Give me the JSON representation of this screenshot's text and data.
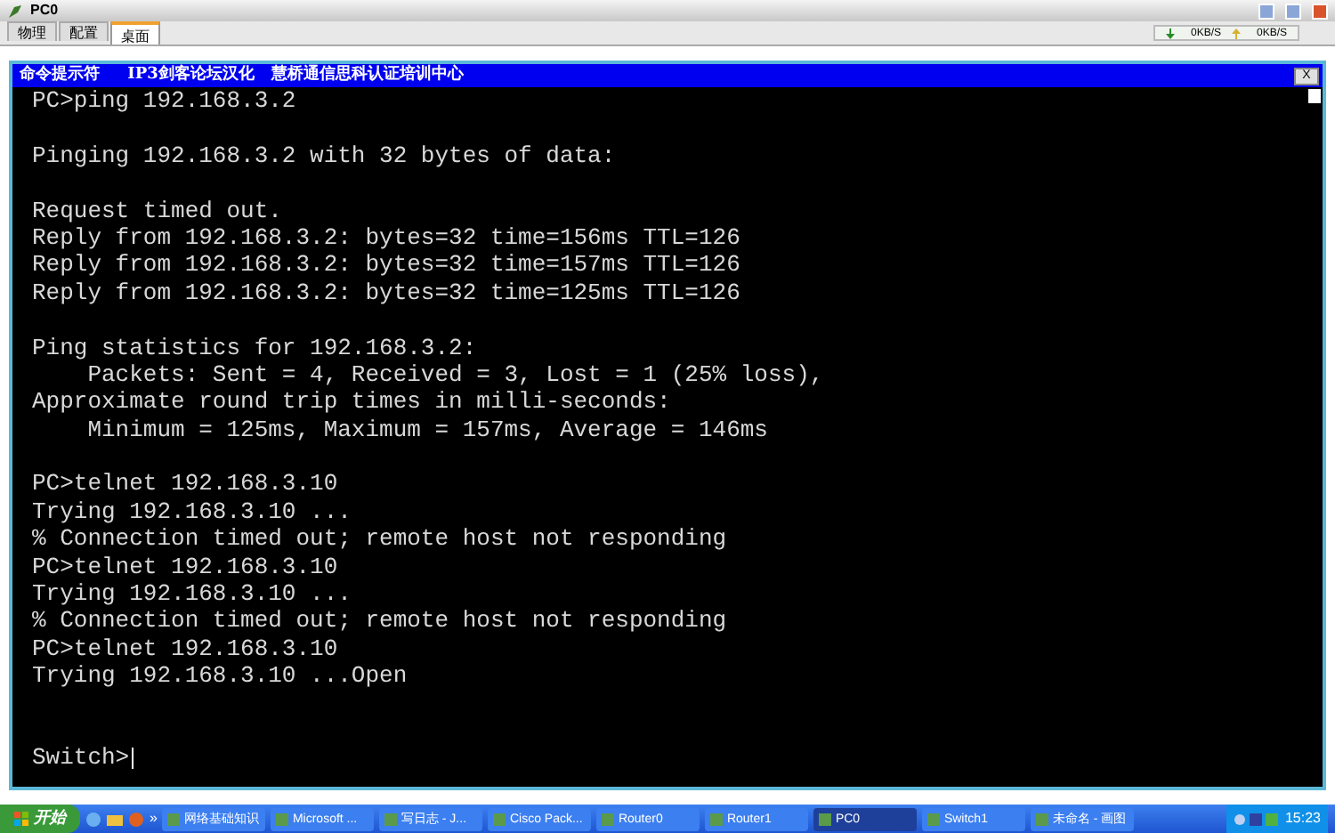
{
  "window": {
    "title": "PC0"
  },
  "tabs": [
    {
      "label": "物理",
      "selected": false
    },
    {
      "label": "配置",
      "selected": false
    },
    {
      "label": "桌面",
      "selected": true
    }
  ],
  "net_speed": {
    "download": "0KB/S",
    "upload": "0KB/S"
  },
  "console": {
    "title": "命令提示符     IP3剑客论坛汉化   慧桥通信思科认证培训中心",
    "close": "X",
    "lines": [
      {
        "kind": "text",
        "text": "PC>ping 192.168.3.2"
      },
      {
        "kind": "blank"
      },
      {
        "kind": "text",
        "text": "Pinging 192.168.3.2 with 32 bytes of data:"
      },
      {
        "kind": "blank"
      },
      {
        "kind": "text",
        "text": "Request timed out."
      },
      {
        "kind": "text",
        "text": "Reply from 192.168.3.2: bytes=32 time=156ms TTL=126"
      },
      {
        "kind": "text",
        "text": "Reply from 192.168.3.2: bytes=32 time=157ms TTL=126"
      },
      {
        "kind": "text",
        "text": "Reply from 192.168.3.2: bytes=32 time=125ms TTL=126"
      },
      {
        "kind": "blank"
      },
      {
        "kind": "text",
        "text": "Ping statistics for 192.168.3.2:"
      },
      {
        "kind": "text",
        "text": "    Packets: Sent = 4, Received = 3, Lost = 1 (25% loss),"
      },
      {
        "kind": "text",
        "text": "Approximate round trip times in milli-seconds:"
      },
      {
        "kind": "text",
        "text": "    Minimum = 125ms, Maximum = 157ms, Average = 146ms"
      },
      {
        "kind": "blank"
      },
      {
        "kind": "text",
        "text": "PC>telnet 192.168.3.10"
      },
      {
        "kind": "text",
        "text": "Trying 192.168.3.10 ..."
      },
      {
        "kind": "text",
        "text": "% Connection timed out; remote host not responding"
      },
      {
        "kind": "text",
        "text": "PC>telnet 192.168.3.10"
      },
      {
        "kind": "text",
        "text": "Trying 192.168.3.10 ..."
      },
      {
        "kind": "text",
        "text": "% Connection timed out; remote host not responding"
      },
      {
        "kind": "text",
        "text": "PC>telnet 192.168.3.10"
      },
      {
        "kind": "text",
        "text": "Trying 192.168.3.10 ...Open"
      },
      {
        "kind": "blank"
      },
      {
        "kind": "blank"
      },
      {
        "kind": "text",
        "text": "Switch>"
      }
    ]
  },
  "taskbar": {
    "start": "开始",
    "quick_launch_more": "»",
    "items": [
      {
        "label": "网络基础知识",
        "selected": false
      },
      {
        "label": "Microsoft ...",
        "selected": false
      },
      {
        "label": "写日志 - J...",
        "selected": false
      },
      {
        "label": "Cisco Pack...",
        "selected": false
      },
      {
        "label": "Router0",
        "selected": false
      },
      {
        "label": "Router1",
        "selected": false
      },
      {
        "label": "PC0",
        "selected": true
      },
      {
        "label": "Switch1",
        "selected": false
      },
      {
        "label": "未命名 - 画图",
        "selected": false
      }
    ],
    "clock": "15:23"
  }
}
